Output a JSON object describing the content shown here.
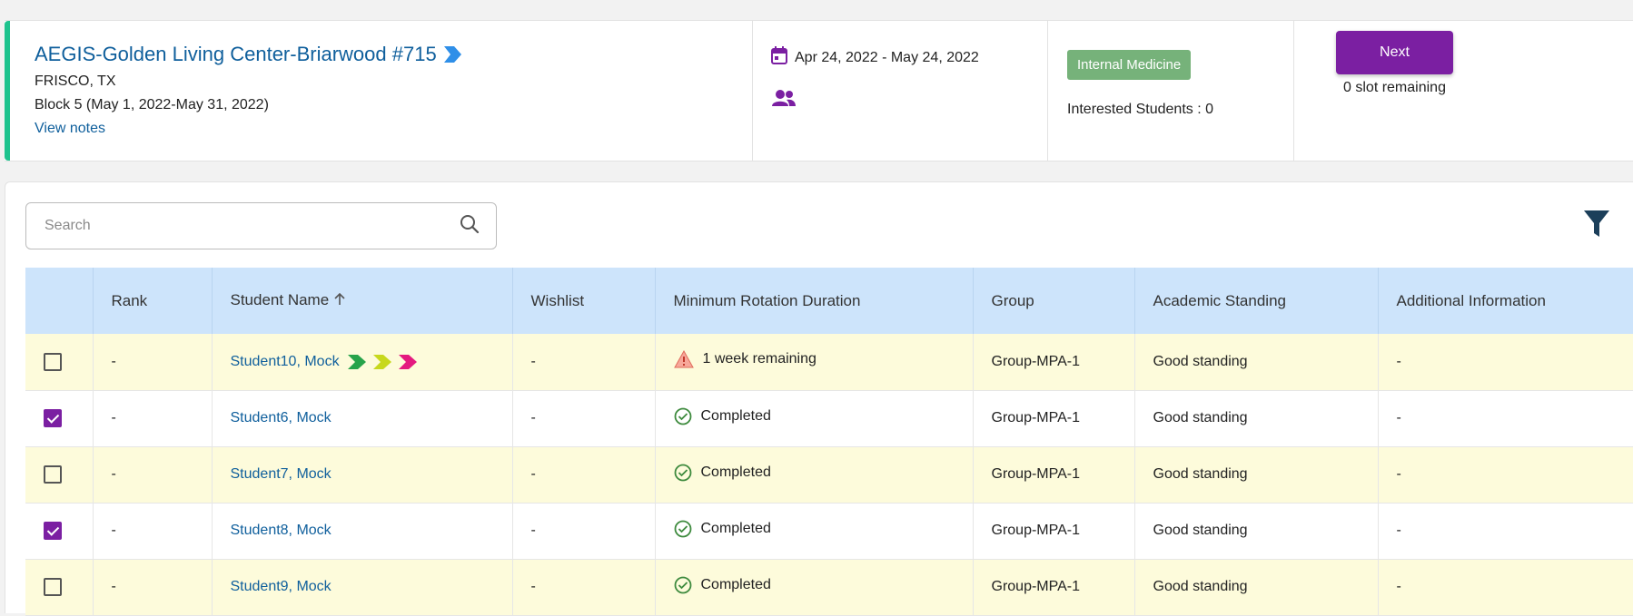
{
  "site": {
    "name": "AEGIS-Golden Living Center-Briarwood #715",
    "location": "FRISCO, TX",
    "block": "Block 5 (May 1, 2022-May 31, 2022)",
    "view_notes": "View notes"
  },
  "dates": {
    "range": "Apr 24, 2022 - May 24, 2022"
  },
  "specialty": {
    "badge": "Internal Medicine",
    "interested": "Interested Students : 0"
  },
  "actions": {
    "next_label": "Next",
    "slots": "0 slot remaining"
  },
  "search": {
    "placeholder": "Search"
  },
  "table": {
    "headers": [
      "Rank",
      "Student Name",
      "Wishlist",
      "Minimum Rotation Duration",
      "Group",
      "Academic Standing",
      "Additional Information"
    ],
    "rows": [
      {
        "rank": "-",
        "name": "Student10, Mock",
        "wishlist": "-",
        "duration": "1 week remaining",
        "group": "Group-MPA-1",
        "standing": "Good standing",
        "info": "-"
      },
      {
        "rank": "-",
        "name": "Student6, Mock",
        "wishlist": "-",
        "duration": "Completed",
        "group": "Group-MPA-1",
        "standing": "Good standing",
        "info": "-"
      },
      {
        "rank": "-",
        "name": "Student7, Mock",
        "wishlist": "-",
        "duration": "Completed",
        "group": "Group-MPA-1",
        "standing": "Good standing",
        "info": "-"
      },
      {
        "rank": "-",
        "name": "Student8, Mock",
        "wishlist": "-",
        "duration": "Completed",
        "group": "Group-MPA-1",
        "standing": "Good standing",
        "info": "-"
      },
      {
        "rank": "-",
        "name": "Student9, Mock",
        "wishlist": "-",
        "duration": "Completed",
        "group": "Group-MPA-1",
        "standing": "Good standing",
        "info": "-"
      }
    ]
  },
  "colors": {
    "accent": "#7b1fa2",
    "link": "#0f5f9c",
    "header_bg": "#cde4fb",
    "row_alt": "#fdfbdb",
    "badge": "#76b27a",
    "card_accent": "#1ec38e"
  }
}
